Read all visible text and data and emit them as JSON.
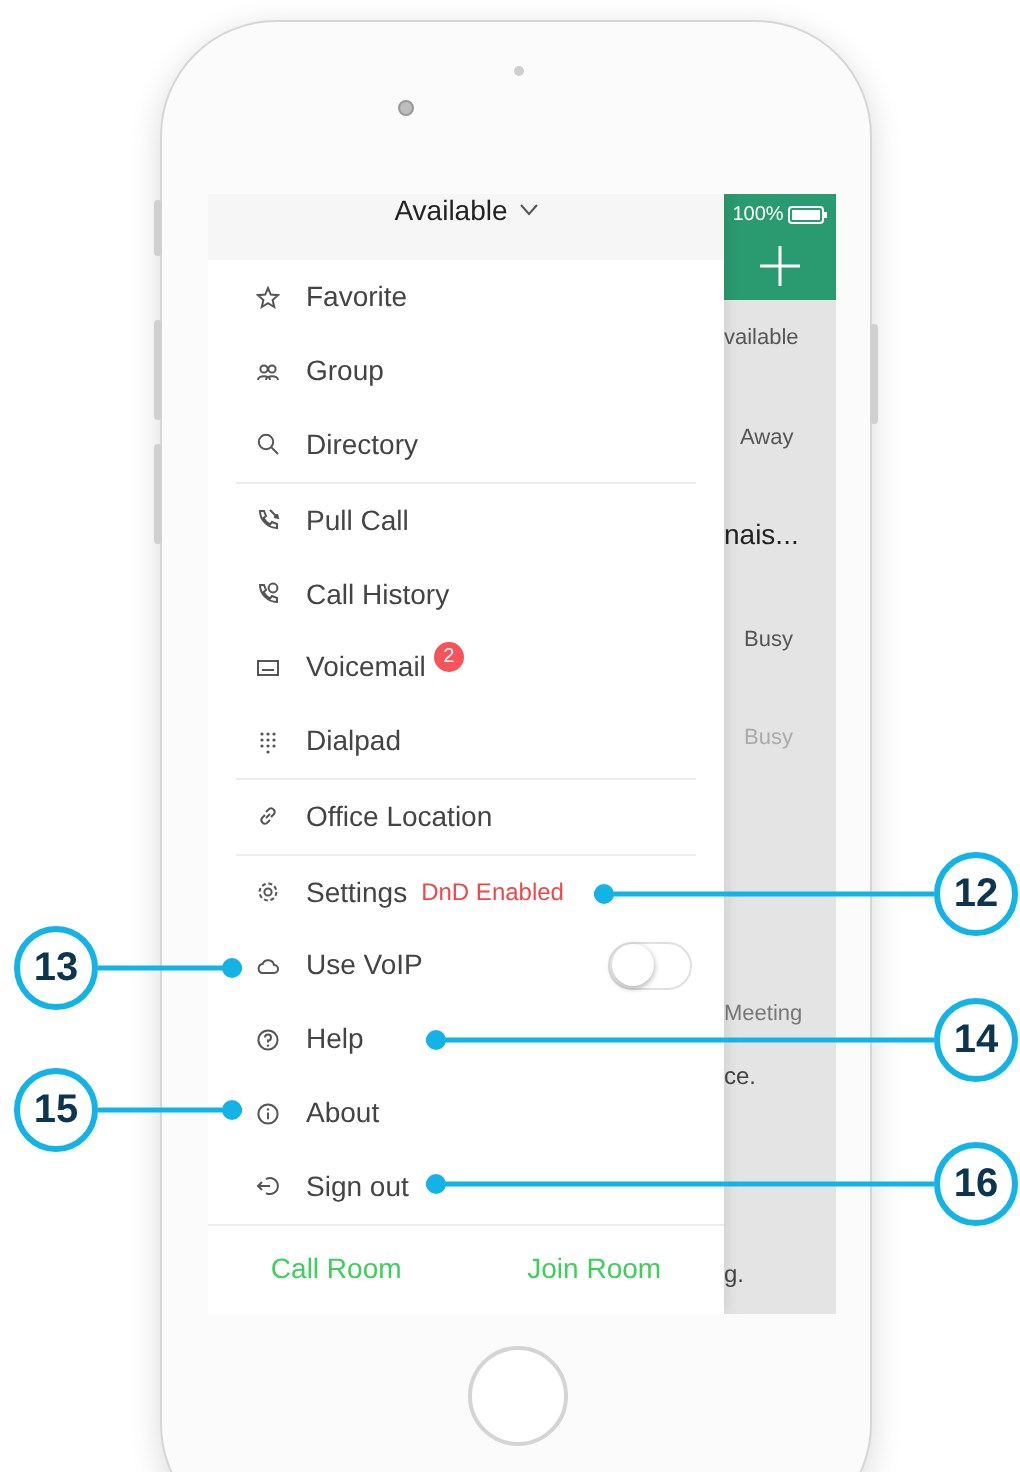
{
  "status_bar": {
    "battery": "100%"
  },
  "presence": {
    "label": "Available"
  },
  "background_list": [
    "vailable",
    "Away",
    "nais...",
    "Busy",
    "Busy",
    "Meeting",
    "ce.",
    "g."
  ],
  "menu": {
    "sections": [
      [
        {
          "kind": "item",
          "label": "Favorite"
        },
        {
          "kind": "item",
          "label": "Group"
        },
        {
          "kind": "item",
          "label": "Directory"
        }
      ],
      [
        {
          "kind": "item",
          "label": "Pull Call"
        },
        {
          "kind": "item",
          "label": "Call History"
        },
        {
          "kind": "badge",
          "label": "Voicemail",
          "badge": "2"
        },
        {
          "kind": "item",
          "label": "Dialpad"
        }
      ],
      [
        {
          "kind": "item",
          "label": "Office Location"
        }
      ],
      [
        {
          "kind": "tag",
          "label": "Settings",
          "tag": "DnD Enabled"
        },
        {
          "kind": "toggle",
          "label": "Use VoIP",
          "on": false
        },
        {
          "kind": "item",
          "label": "Help"
        },
        {
          "kind": "item",
          "label": "About"
        },
        {
          "kind": "item",
          "label": "Sign out"
        }
      ]
    ]
  },
  "footer_buttons": [
    "Call Room",
    "Join Room"
  ],
  "callouts": [
    {
      "number": "12"
    },
    {
      "number": "13"
    },
    {
      "number": "14"
    },
    {
      "number": "15"
    },
    {
      "number": "16"
    }
  ]
}
